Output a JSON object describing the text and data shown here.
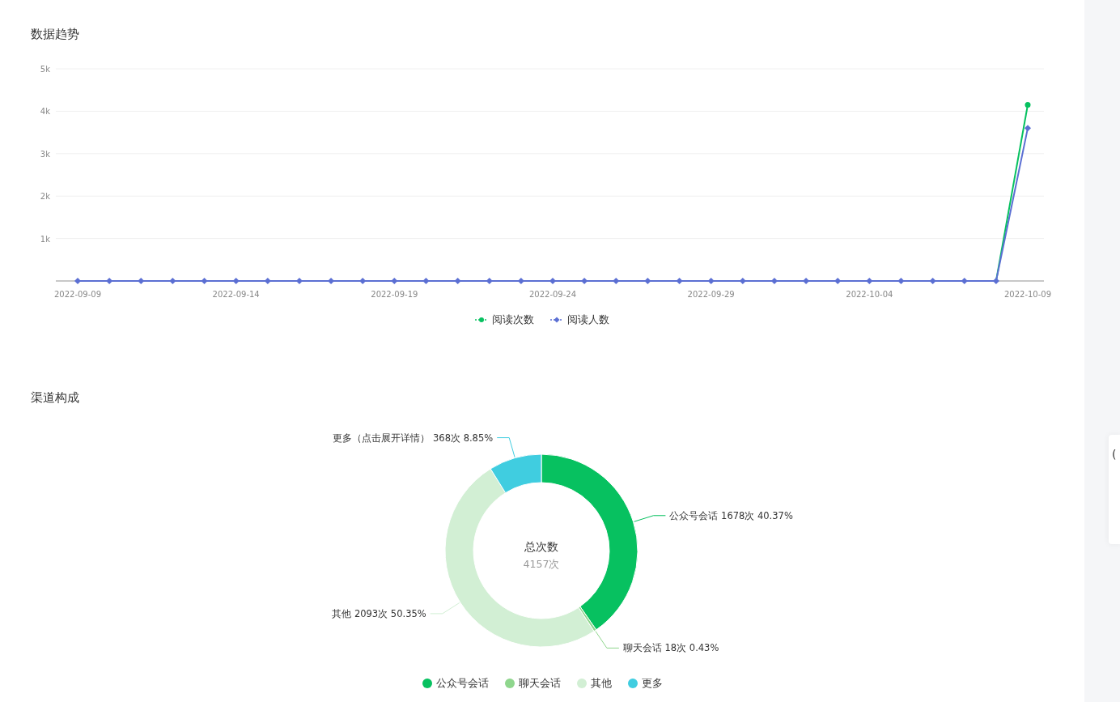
{
  "trend": {
    "title": "数据趋势",
    "chart_data": {
      "type": "line",
      "categories": [
        "2022-09-09",
        null,
        null,
        null,
        null,
        "2022-09-14",
        null,
        null,
        null,
        null,
        "2022-09-19",
        null,
        null,
        null,
        null,
        "2022-09-24",
        null,
        null,
        null,
        null,
        "2022-09-29",
        null,
        null,
        null,
        null,
        "2022-10-04",
        null,
        null,
        null,
        null,
        "2022-10-09"
      ],
      "ylim": [
        0,
        5000
      ],
      "grid": true,
      "yticks": [
        {
          "value": 1000,
          "label": "1k"
        },
        {
          "value": 2000,
          "label": "2k"
        },
        {
          "value": 3000,
          "label": "3k"
        },
        {
          "value": 4000,
          "label": "4k"
        },
        {
          "value": 5000,
          "label": "5k"
        }
      ],
      "series": [
        {
          "name": "阅读次数",
          "color": "#07c160",
          "marker": "circle",
          "values": [
            null,
            null,
            null,
            null,
            null,
            null,
            null,
            null,
            null,
            null,
            null,
            null,
            null,
            null,
            null,
            null,
            null,
            null,
            null,
            null,
            null,
            null,
            null,
            null,
            null,
            null,
            null,
            null,
            null,
            0,
            4150
          ]
        },
        {
          "name": "阅读人数",
          "color": "#5b6fd3",
          "marker": "diamond",
          "values": [
            0,
            0,
            0,
            0,
            0,
            0,
            0,
            0,
            0,
            0,
            0,
            0,
            0,
            0,
            0,
            0,
            0,
            0,
            0,
            0,
            0,
            0,
            0,
            0,
            0,
            0,
            0,
            0,
            0,
            0,
            3600
          ]
        }
      ]
    }
  },
  "channels": {
    "title": "渠道构成",
    "center_title": "总次数",
    "center_value": "4157次",
    "chart_data": {
      "type": "donut",
      "categories": [
        "公众号会话",
        "聊天会话",
        "其他",
        "更多"
      ],
      "values": [
        1678,
        18,
        2093,
        368
      ],
      "colors": [
        "#07c160",
        "#8fd68d",
        "#d2efd4",
        "#40cde0"
      ],
      "value_labels": [
        "公众号会话 1678次 40.37%",
        "聊天会话 18次 0.43%",
        "其他 2093次 50.35%",
        "更多（点击展开详情） 368次 8.85%"
      ]
    }
  },
  "side_card": {
    "text": "("
  }
}
